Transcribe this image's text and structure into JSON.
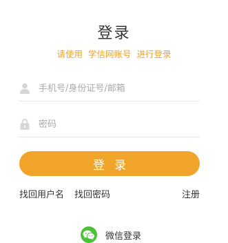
{
  "login": {
    "title": "登录",
    "subtitle_parts": [
      "请使用",
      "学信网账号",
      "进行登录"
    ],
    "username_placeholder": "手机号/身份证号/邮箱",
    "password_placeholder": "密码",
    "submit_label": "登录",
    "links": {
      "find_username": "找回用户名",
      "find_password": "找回密码",
      "register": "注册"
    },
    "wechat_label": "微信登录"
  },
  "icons": {
    "user": "user-icon",
    "lock": "lock-icon",
    "wechat": "wechat-icon"
  },
  "colors": {
    "accent": "#f0a52a",
    "subtitle": "#e8a32c",
    "wechat_green": "#4bc235"
  }
}
